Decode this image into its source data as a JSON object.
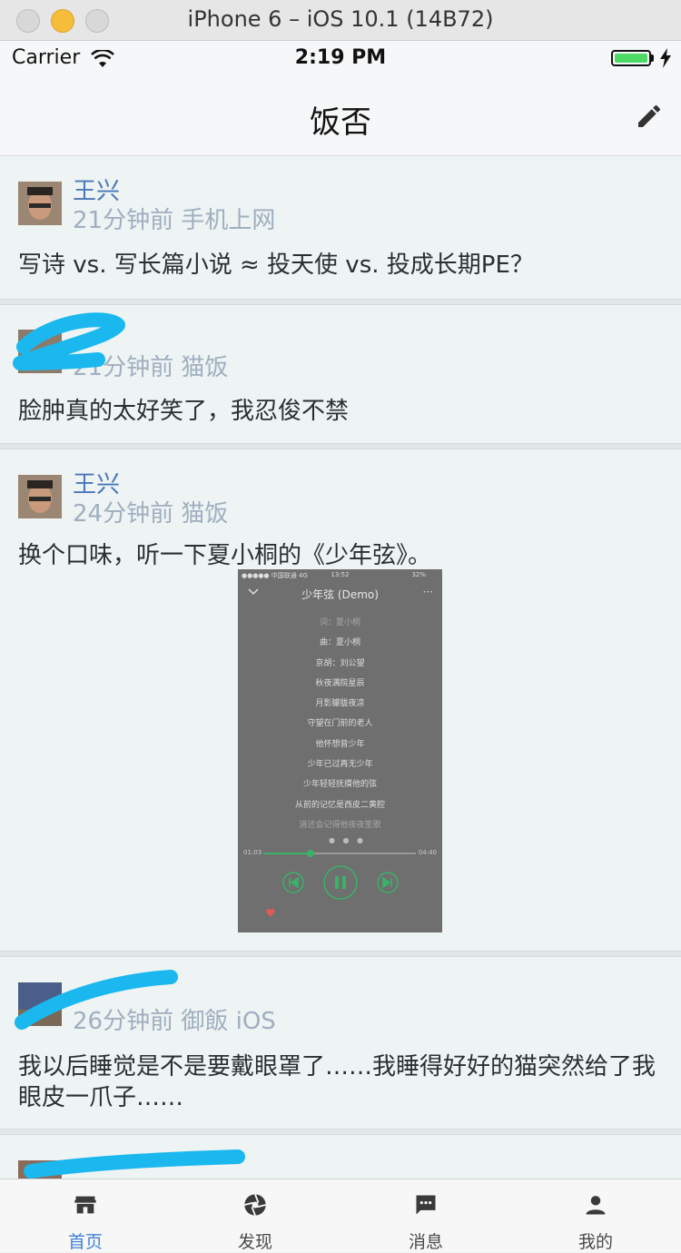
{
  "window": {
    "title": "iPhone 6 – iOS 10.1 (14B72)"
  },
  "status_bar": {
    "carrier": "Carrier",
    "time": "2:19 PM",
    "battery_level": 1.0
  },
  "nav": {
    "title": "饭否",
    "compose_icon": "pencil-icon"
  },
  "posts": [
    {
      "name": "王兴",
      "meta": "21分钟前 手机上网",
      "text": "写诗 vs. 写长篇小说 ≈ 投天使 vs. 投成长期PE？"
    },
    {
      "name": "",
      "meta": "21分钟前 猫饭",
      "text": "脸肿真的太好笑了，我忍俊不禁"
    },
    {
      "name": "王兴",
      "meta": "24分钟前 猫饭",
      "text": "换个口味，听一下夏小桐的《少年弦》。",
      "photo": {
        "status": "●●●●● 中国联通 4G",
        "clock": "13:52",
        "battery": "32%",
        "title": "少年弦 (Demo)",
        "lyrics": [
          "词：夏小桐",
          "曲：夏小桐",
          "京胡：刘公望",
          "秋夜满院星辰",
          "月影朦胧夜凉",
          "守望在门前的老人",
          "他怀想曾少年",
          "少年已过再无少年",
          "少年轻轻抚摸他的弦",
          "从前的记忆是西皮二黄腔",
          "道还会记得他夜夜笙歌"
        ],
        "time_start": "01:03",
        "time_end": "04:40",
        "progress": 0.31
      }
    },
    {
      "name": "",
      "meta": "26分钟前 御飯 iOS",
      "text": "我以后睡觉是不是要戴眼罩了……我睡得好好的猫突然给了我眼皮一爪子……"
    },
    {
      "name": "",
      "meta": "",
      "text": ""
    }
  ],
  "tabs": [
    {
      "label": "首页",
      "icon": "store-icon",
      "active": true
    },
    {
      "label": "发现",
      "icon": "aperture-icon",
      "active": false
    },
    {
      "label": "消息",
      "icon": "chat-icon",
      "active": false
    },
    {
      "label": "我的",
      "icon": "person-icon",
      "active": false
    }
  ],
  "colors": {
    "accent": "#3f82d6",
    "name": "#4a78b8",
    "meta": "#9fafbf",
    "redaction": "#1ab8ee"
  }
}
